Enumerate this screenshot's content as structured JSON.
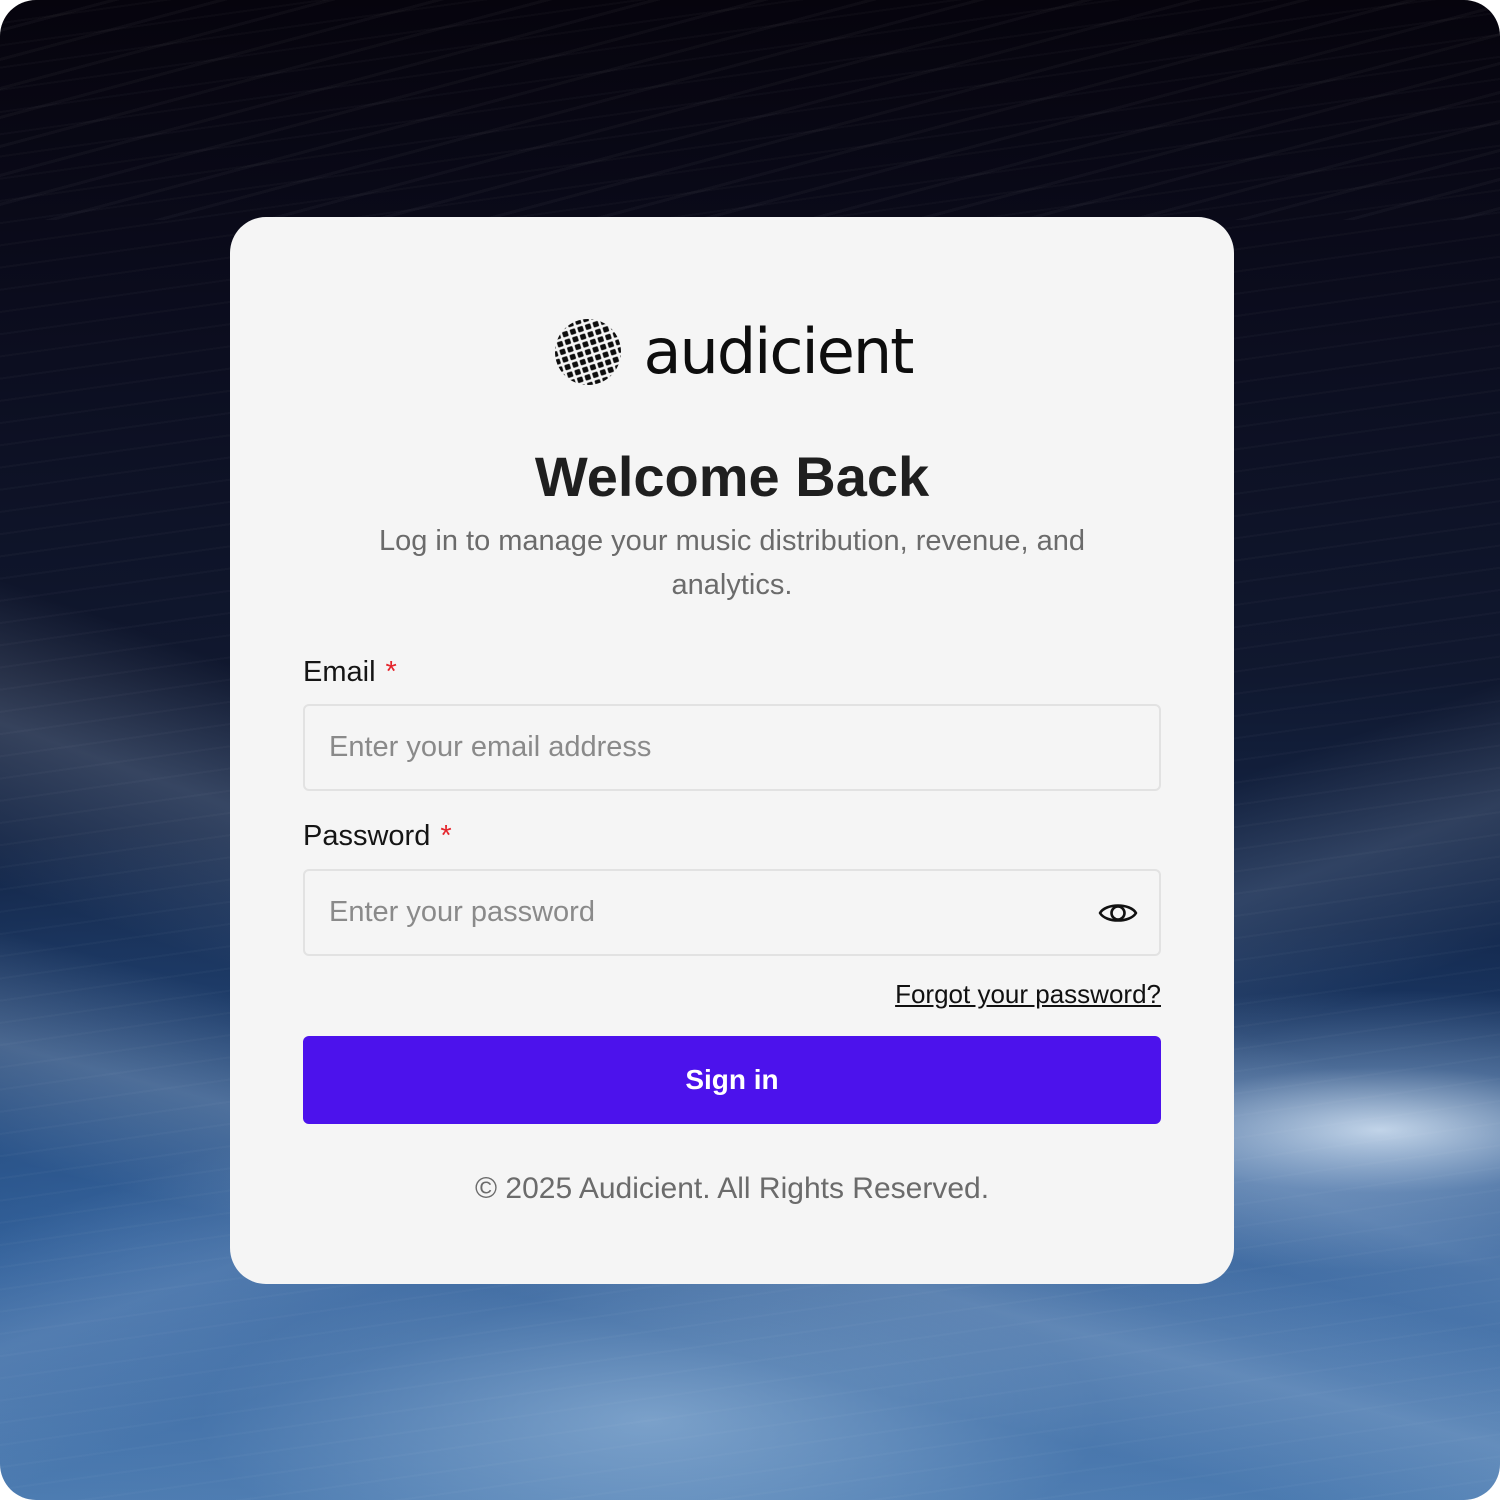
{
  "brand": {
    "name": "audicient",
    "logo_icon": "dotted-globe-icon"
  },
  "login": {
    "title": "Welcome Back",
    "subtitle": "Log in to manage your music distribution, revenue, and analytics.",
    "email": {
      "label": "Email",
      "required_mark": "*",
      "placeholder": "Enter your email address",
      "value": ""
    },
    "password": {
      "label": "Password",
      "required_mark": "*",
      "placeholder": "Enter your password",
      "value": "",
      "toggle_icon": "eye-icon"
    },
    "forgot_link": "Forgot your password?",
    "submit_label": "Sign in"
  },
  "footer": {
    "copyright": "© 2025 Audicient. All Rights Reserved."
  },
  "colors": {
    "primary_button": "#4c12ec",
    "required_asterisk": "#e5242b",
    "card_background": "#f5f5f5"
  }
}
